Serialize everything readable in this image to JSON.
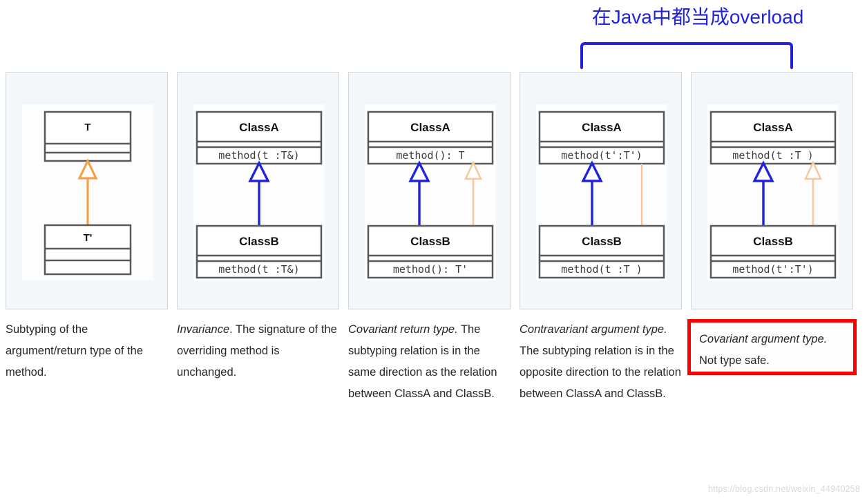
{
  "annotation": {
    "text": "在Java中都当成overload",
    "color": "#2222DD"
  },
  "colors": {
    "panel_background": "#f4f7fa",
    "panel_border": "#d3d6d9",
    "inherit_blue": "#2222DD",
    "inherit_orange_strong": "#F5A14B",
    "inherit_orange_light": "#F7C79A",
    "highlight_red": "#FF0000",
    "class_box_border": "#595959"
  },
  "panels": [
    {
      "id": "panel-subtyping",
      "super_class": {
        "name": "T",
        "members": [
          "",
          ""
        ]
      },
      "sub_class": {
        "name": "T'",
        "members": [
          "",
          ""
        ]
      },
      "arrows": [
        {
          "name": "subtype-arrow",
          "color": "#F5A14B",
          "direction": "up",
          "position": "center"
        }
      ],
      "caption": {
        "term": "",
        "rest": "Subtyping of the argument/return type of the method.",
        "boxed": false
      }
    },
    {
      "id": "panel-invariance",
      "super_class": {
        "name": "ClassA",
        "members": [
          "method(t :T&)"
        ]
      },
      "sub_class": {
        "name": "ClassB",
        "members": [
          "method(t :T&)"
        ]
      },
      "arrows": [
        {
          "name": "inheritance-arrow",
          "color": "#2222DD",
          "direction": "up",
          "position": "center"
        }
      ],
      "caption": {
        "term": "Invariance",
        "rest": ". The signature of the overriding method is unchanged.",
        "boxed": false
      }
    },
    {
      "id": "panel-covariant-return",
      "super_class": {
        "name": "ClassA",
        "members": [
          "method(): T"
        ]
      },
      "sub_class": {
        "name": "ClassB",
        "members": [
          "method(): T'"
        ]
      },
      "arrows": [
        {
          "name": "inheritance-arrow",
          "color": "#2222DD",
          "direction": "up",
          "position": "left"
        },
        {
          "name": "return-subtype-arrow",
          "color": "#F7C79A",
          "direction": "up",
          "position": "right"
        }
      ],
      "caption": {
        "term": "Covariant return type.",
        "rest": " The subtyping relation is in the same direction as the relation between ClassA and ClassB.",
        "boxed": false
      }
    },
    {
      "id": "panel-contravariant-argument",
      "super_class": {
        "name": "ClassA",
        "members": [
          "method(t':T')"
        ]
      },
      "sub_class": {
        "name": "ClassB",
        "members": [
          "method(t :T )"
        ]
      },
      "arrows": [
        {
          "name": "inheritance-arrow",
          "color": "#2222DD",
          "direction": "up",
          "position": "left"
        },
        {
          "name": "argument-subtype-arrow",
          "color": "#F7C79A",
          "direction": "down",
          "position": "right"
        }
      ],
      "caption": {
        "term": "Contravariant argument type.",
        "rest": " The subtyping relation is in the opposite direction to the relation between ClassA and ClassB.",
        "boxed": false
      }
    },
    {
      "id": "panel-covariant-argument",
      "super_class": {
        "name": "ClassA",
        "members": [
          "method(t :T )"
        ]
      },
      "sub_class": {
        "name": "ClassB",
        "members": [
          "method(t':T')"
        ]
      },
      "arrows": [
        {
          "name": "inheritance-arrow",
          "color": "#2222DD",
          "direction": "up",
          "position": "left"
        },
        {
          "name": "argument-subtype-arrow",
          "color": "#F7C79A",
          "direction": "up",
          "position": "right"
        }
      ],
      "caption": {
        "term": "Covariant argument type.",
        "rest": " Not type safe.",
        "boxed": true
      }
    }
  ],
  "watermark": "https://blog.csdn.net/weixin_44940258"
}
